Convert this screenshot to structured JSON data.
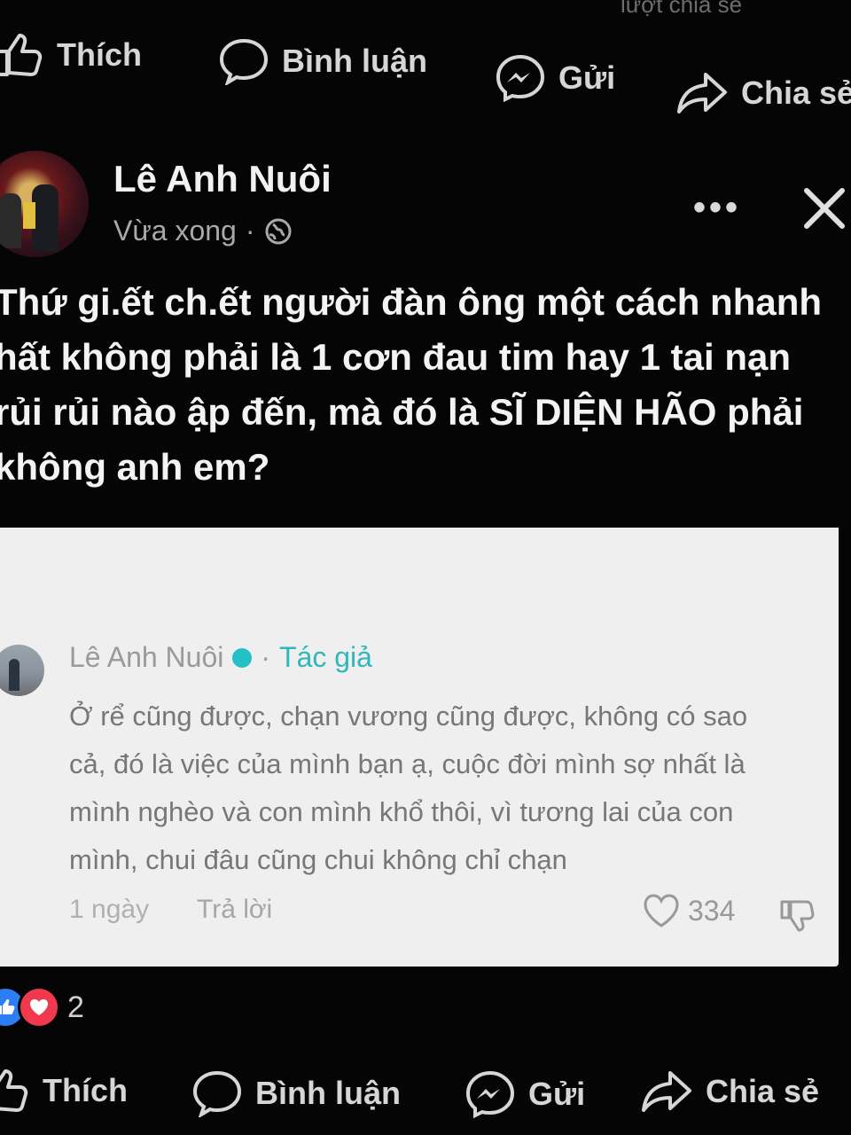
{
  "top_partial_text": "lượt chia sẻ",
  "action_bar": {
    "like_label": "Thích",
    "comment_label": "Bình luận",
    "send_label": "Gửi",
    "share_label": "Chia sẻ"
  },
  "post": {
    "author": "Lê Anh Nuôi",
    "time": "Vừa xong",
    "separator": "·",
    "privacy_icon": "globe-icon",
    "more_icon": "more-dots-icon",
    "more_glyph": "•••",
    "close_icon": "close-icon",
    "text": "Thứ gi.ết ch.ết người đàn ông một cách nhanh\nhất không phải là 1 cơn đau tim hay 1 tai nạn\nrủi rủi nào ập đến, mà đó là SĨ DIỆN HÃO phải\nkhông anh em?"
  },
  "comment": {
    "author": "Lê Anh Nuôi",
    "separator": "·",
    "author_badge": "Tác giả",
    "text": "Ở rể cũng được, chạn vương cũng được, không có sao\ncả, đó là việc của mình bạn ạ, cuộc đời mình sợ nhất là\nmình nghèo và con mình khổ thôi, vì tương lai của con\nmình, chui đâu cũng chui không chỉ chạn",
    "date": "1 ngày",
    "reply_label": "Trả lời",
    "like_count": "334"
  },
  "reactions": {
    "count": "2"
  },
  "bottom_bar": {
    "like_label": "Thích",
    "comment_label": "Bình luận",
    "send_label": "Gửi",
    "share_label": "Chia sẻ"
  },
  "colors": {
    "background": "#050505",
    "card_background": "#efefef",
    "author_badge": "#2fb8bc",
    "like_reaction": "#2d7df6",
    "love_reaction": "#f0384f"
  }
}
